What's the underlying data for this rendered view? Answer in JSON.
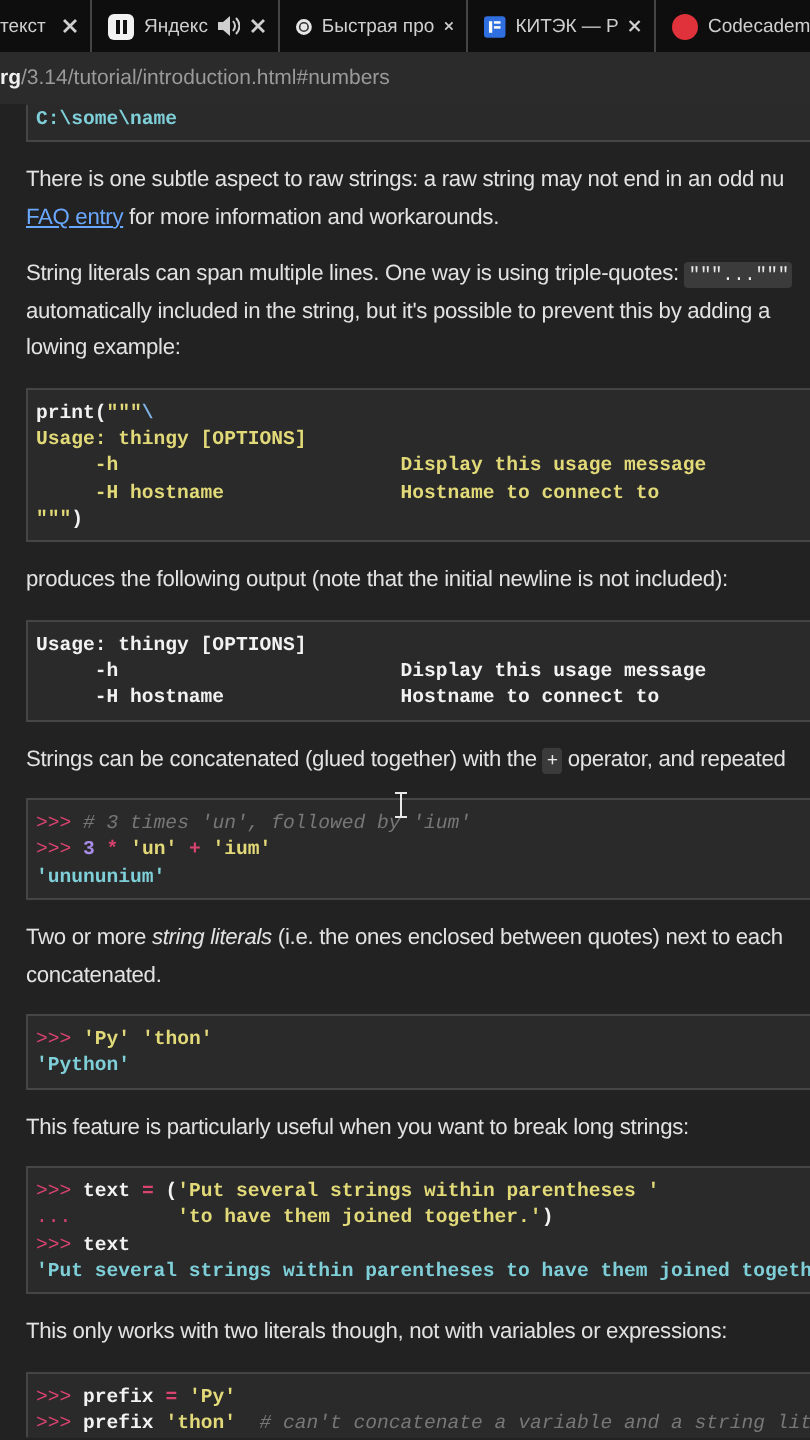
{
  "tabs": [
    {
      "label": "текст",
      "audio": false
    },
    {
      "label": "Яндекс",
      "audio": true
    },
    {
      "label": "Быстрая про",
      "audio": false
    },
    {
      "label": "КИТЭК — Р",
      "audio": false
    },
    {
      "label": "Codecadem",
      "audio": false
    }
  ],
  "address_bar": {
    "domain": "rg",
    "path": "/3.14/tutorial/introduction.html#numbers"
  },
  "content": [
    {
      "kind": "code",
      "lines": [
        [
          {
            "kind": "output",
            "text": "C:\\some\\name"
          }
        ]
      ]
    },
    {
      "kind": "para",
      "lines": [
        [
          {
            "kind": "text",
            "text": "There is one subtle aspect to raw strings: a raw string may not end in an odd nu"
          }
        ],
        [
          {
            "kind": "link",
            "text": "FAQ entry"
          },
          {
            "kind": "text",
            "text": " for more information and workarounds."
          }
        ]
      ]
    },
    {
      "kind": "para",
      "lines": [
        [
          {
            "kind": "text",
            "text": "String literals can span multiple lines. One way is using triple-quotes: "
          },
          {
            "kind": "code",
            "text": "\"\"\"...\"\"\""
          }
        ],
        [
          {
            "kind": "text",
            "text": "automatically included in the string, but it's possible to prevent this by adding a"
          }
        ],
        [
          {
            "kind": "text",
            "text": "lowing example:"
          }
        ]
      ]
    },
    {
      "kind": "code",
      "lines": [
        [
          {
            "kind": "plain",
            "text": "print("
          },
          {
            "kind": "string",
            "text": "\"\"\""
          },
          {
            "kind": "escape",
            "text": "\\"
          }
        ],
        [
          {
            "kind": "string",
            "text": "Usage: thingy [OPTIONS]"
          }
        ],
        [
          {
            "kind": "string",
            "text": "     -h                        Display this usage message"
          }
        ],
        [
          {
            "kind": "string",
            "text": "     -H hostname               Hostname to connect to"
          }
        ],
        [
          {
            "kind": "string",
            "text": "\"\"\""
          },
          {
            "kind": "plain",
            "text": ")"
          }
        ]
      ]
    },
    {
      "kind": "para",
      "lines": [
        [
          {
            "kind": "text",
            "text": "produces the following output (note that the initial newline is not included):"
          }
        ]
      ]
    },
    {
      "kind": "code",
      "lines": [
        [
          {
            "kind": "plain",
            "text": "Usage: thingy [OPTIONS]"
          }
        ],
        [
          {
            "kind": "plain",
            "text": "     -h                        Display this usage message"
          }
        ],
        [
          {
            "kind": "plain",
            "text": "     -H hostname               Hostname to connect to"
          }
        ]
      ]
    },
    {
      "kind": "para",
      "lines": [
        [
          {
            "kind": "text",
            "text": "Strings can be concatenated (glued together) with the "
          },
          {
            "kind": "code",
            "text": "+"
          },
          {
            "kind": "text",
            "text": " operator, and repeated"
          }
        ]
      ]
    },
    {
      "kind": "code",
      "lines": [
        [
          {
            "kind": "prompt",
            "text": ">>> "
          },
          {
            "kind": "comment",
            "text": "# 3 times 'un', followed by 'ium'"
          }
        ],
        [
          {
            "kind": "prompt",
            "text": ">>> "
          },
          {
            "kind": "number",
            "text": "3"
          },
          {
            "kind": "operator",
            "text": " * "
          },
          {
            "kind": "string",
            "text": "'un'"
          },
          {
            "kind": "operator",
            "text": " + "
          },
          {
            "kind": "string",
            "text": "'ium'"
          }
        ],
        [
          {
            "kind": "output",
            "text": "'unununium'"
          }
        ]
      ]
    },
    {
      "kind": "para",
      "lines": [
        [
          {
            "kind": "text",
            "text": "Two or more "
          },
          {
            "kind": "em",
            "text": "string literals"
          },
          {
            "kind": "text",
            "text": " (i.e. the ones enclosed between quotes) next to each"
          }
        ],
        [
          {
            "kind": "text",
            "text": "concatenated."
          }
        ]
      ]
    },
    {
      "kind": "code",
      "lines": [
        [
          {
            "kind": "prompt",
            "text": ">>> "
          },
          {
            "kind": "string",
            "text": "'Py'"
          },
          {
            "kind": "string",
            "text": " 'thon'"
          }
        ],
        [
          {
            "kind": "output",
            "text": "'Python'"
          }
        ]
      ]
    },
    {
      "kind": "para",
      "lines": [
        [
          {
            "kind": "text",
            "text": "This feature is particularly useful when you want to break long strings:"
          }
        ]
      ]
    },
    {
      "kind": "code",
      "lines": [
        [
          {
            "kind": "prompt",
            "text": ">>> "
          },
          {
            "kind": "plain",
            "text": "text "
          },
          {
            "kind": "operator",
            "text": "="
          },
          {
            "kind": "plain",
            "text": " ("
          },
          {
            "kind": "string",
            "text": "'Put several strings within parentheses '"
          }
        ],
        [
          {
            "kind": "prompt",
            "text": "... "
          },
          {
            "kind": "string",
            "text": "        'to have them joined together.'"
          },
          {
            "kind": "plain",
            "text": ")"
          }
        ],
        [
          {
            "kind": "prompt",
            "text": ">>> "
          },
          {
            "kind": "plain",
            "text": "text"
          }
        ],
        [
          {
            "kind": "output",
            "text": "'Put several strings within parentheses to have them joined togeth"
          }
        ]
      ]
    },
    {
      "kind": "para",
      "lines": [
        [
          {
            "kind": "text",
            "text": "This only works with two literals though, not with variables or expressions:"
          }
        ]
      ]
    },
    {
      "kind": "code",
      "lines": [
        [
          {
            "kind": "prompt",
            "text": ">>> "
          },
          {
            "kind": "plain",
            "text": "prefix "
          },
          {
            "kind": "operator",
            "text": "="
          },
          {
            "kind": "string",
            "text": " 'Py'"
          }
        ],
        [
          {
            "kind": "prompt",
            "text": ">>> "
          },
          {
            "kind": "plain",
            "text": "prefix "
          },
          {
            "kind": "string",
            "text": "'thon'"
          },
          {
            "kind": "comment",
            "text": "  # can't concatenate a variable and a string lit"
          }
        ]
      ]
    }
  ]
}
